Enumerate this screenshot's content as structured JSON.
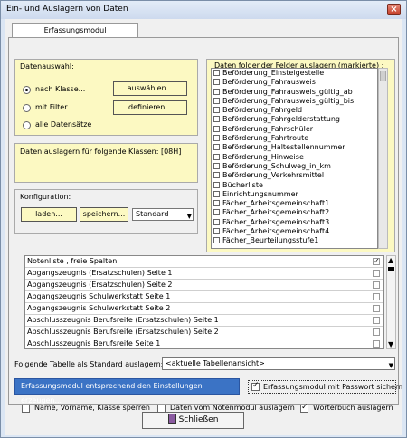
{
  "window": {
    "title": "Ein- und Auslagern von Daten"
  },
  "tab": {
    "label": "Erfassungsmodul"
  },
  "selection": {
    "label": "Datenauswahl:",
    "options": [
      "nach Klasse...",
      "mit Filter...",
      "alle Datensätze"
    ],
    "select_button": "auswählen...",
    "define_button": "definieren..."
  },
  "classes_info": "Daten auslagern für folgende Klassen: [08H]",
  "config": {
    "label": "Konfiguration:",
    "load_button": "laden...",
    "save_button": "speichern...",
    "preset_value": "Standard"
  },
  "fields": {
    "label": "Daten folgender Felder auslagern (markierte) :",
    "items": [
      "Beförderung_Einsteigestelle",
      "Beförderung_Fahrausweis",
      "Beförderung_Fahrausweis_gültig_ab",
      "Beförderung_Fahrausweis_gültig_bis",
      "Beförderung_Fahrgeld",
      "Beförderung_Fahrgelderstattung",
      "Beförderung_Fahrschüler",
      "Beförderung_Fahrtroute",
      "Beförderung_Haltestellennummer",
      "Beförderung_Hinweise",
      "Beförderung_Schulweg_in_km",
      "Beförderung_Verkehrsmittel",
      "Bücherliste",
      "Einrichtungsnummer",
      "Fächer_Arbeitsgemeinschaft1",
      "Fächer_Arbeitsgemeinschaft2",
      "Fächer_Arbeitsgemeinschaft3",
      "Fächer_Arbeitsgemeinschaft4",
      "Fächer_Beurteilungsstufe1"
    ]
  },
  "tables": {
    "rows": [
      {
        "name": "Notenliste , freie Spalten",
        "checked": true
      },
      {
        "name": "Abgangszeugnis (Ersatzschulen) Seite 1",
        "checked": false
      },
      {
        "name": "Abgangszeugnis (Ersatzschulen) Seite 2",
        "checked": false
      },
      {
        "name": "Abgangszeugnis Schulwerkstatt Seite 1",
        "checked": false
      },
      {
        "name": "Abgangszeugnis Schulwerkstatt Seite 2",
        "checked": false
      },
      {
        "name": "Abschlusszeugnis Berufsreife (Ersatzschulen) Seite 1",
        "checked": false
      },
      {
        "name": "Abschlusszeugnis Berufsreife (Ersatzschulen) Seite 2",
        "checked": false
      },
      {
        "name": "Abschlusszeugnis Berufsreife Seite 1",
        "checked": false
      }
    ]
  },
  "default_table": {
    "label": "Folgende Tabelle als Standard auslagern:",
    "value": "<aktuelle Tabellenansicht>"
  },
  "actions": {
    "create_button": "Erfassungsmodul entsprechend den Einstellungen erzeugen...",
    "password_label": "Erfassungsmodul mit Passwort sichern",
    "lock_names_label": "Name, Vorname, Klasse sperren",
    "export_grades_label": "Daten vom Notenmodul auslagern",
    "export_dictionary_label": "Wörterbuch auslagern"
  },
  "footer": {
    "close_button": "Schließen"
  }
}
